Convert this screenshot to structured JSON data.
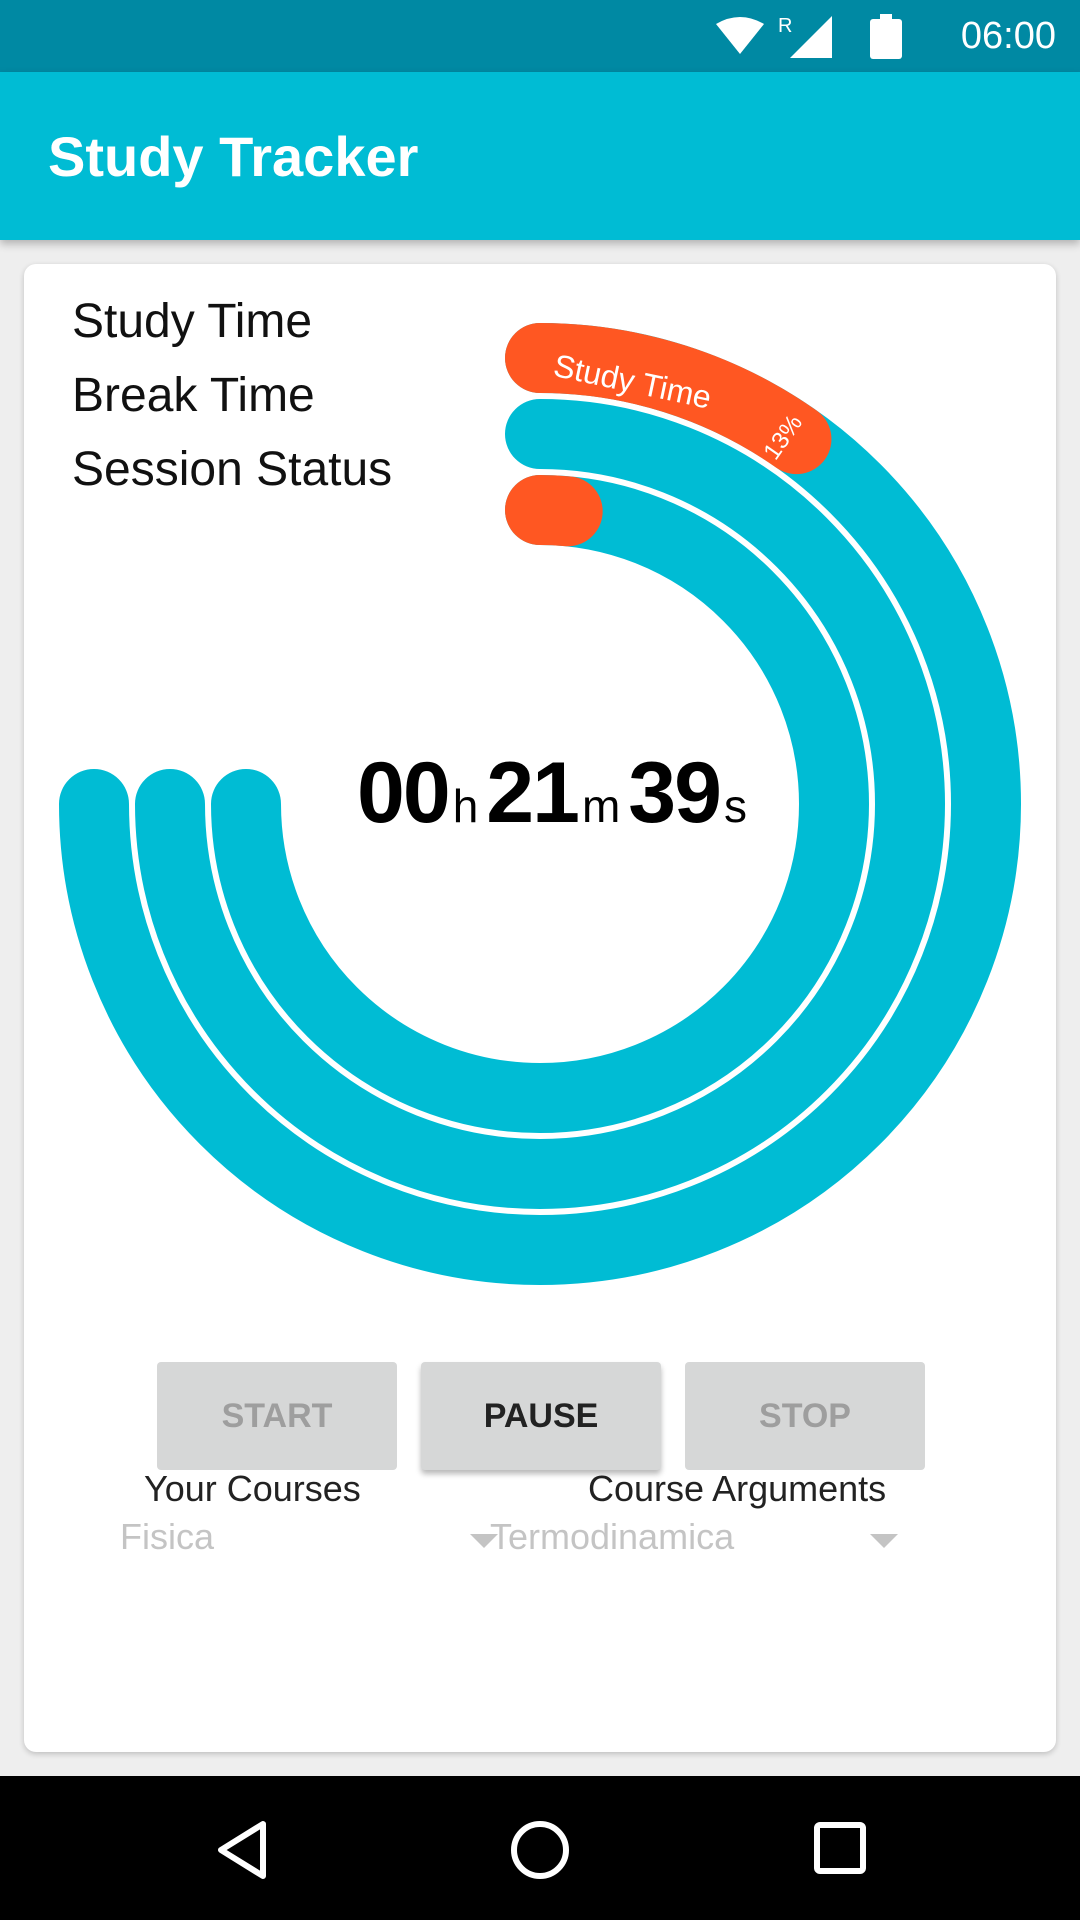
{
  "status_bar": {
    "time": "06:00",
    "icons": [
      "wifi-icon",
      "signal-icon",
      "battery-icon"
    ],
    "roaming_label": "R"
  },
  "app_bar": {
    "title": "Study Tracker",
    "color": "#00bcd4"
  },
  "legend": {
    "items": [
      {
        "label": "Study Time"
      },
      {
        "label": "Break Time"
      },
      {
        "label": "Session Status"
      }
    ]
  },
  "chart_data": {
    "type": "radial-bar",
    "colors": {
      "track": "#00bcd4",
      "progress": "#ff5722"
    },
    "series": [
      {
        "name": "Study Time",
        "value": 0.13,
        "label": "Study Time",
        "percent_label": "13%"
      },
      {
        "name": "Break Time",
        "value": 0
      },
      {
        "name": "Session Status",
        "value": 0.02
      }
    ]
  },
  "timer": {
    "hours": "00",
    "hours_unit": "h",
    "minutes": "21",
    "minutes_unit": "m",
    "seconds": "39",
    "seconds_unit": "s"
  },
  "courses": {
    "label": "Your Courses",
    "selected": "Fisica"
  },
  "arguments": {
    "label": "Course Arguments",
    "selected": "Termodinamica"
  },
  "buttons": {
    "start": "START",
    "pause": "PAUSE",
    "stop": "STOP"
  },
  "nav_bar": {
    "icons": [
      "back-icon",
      "home-icon",
      "recents-icon"
    ]
  }
}
